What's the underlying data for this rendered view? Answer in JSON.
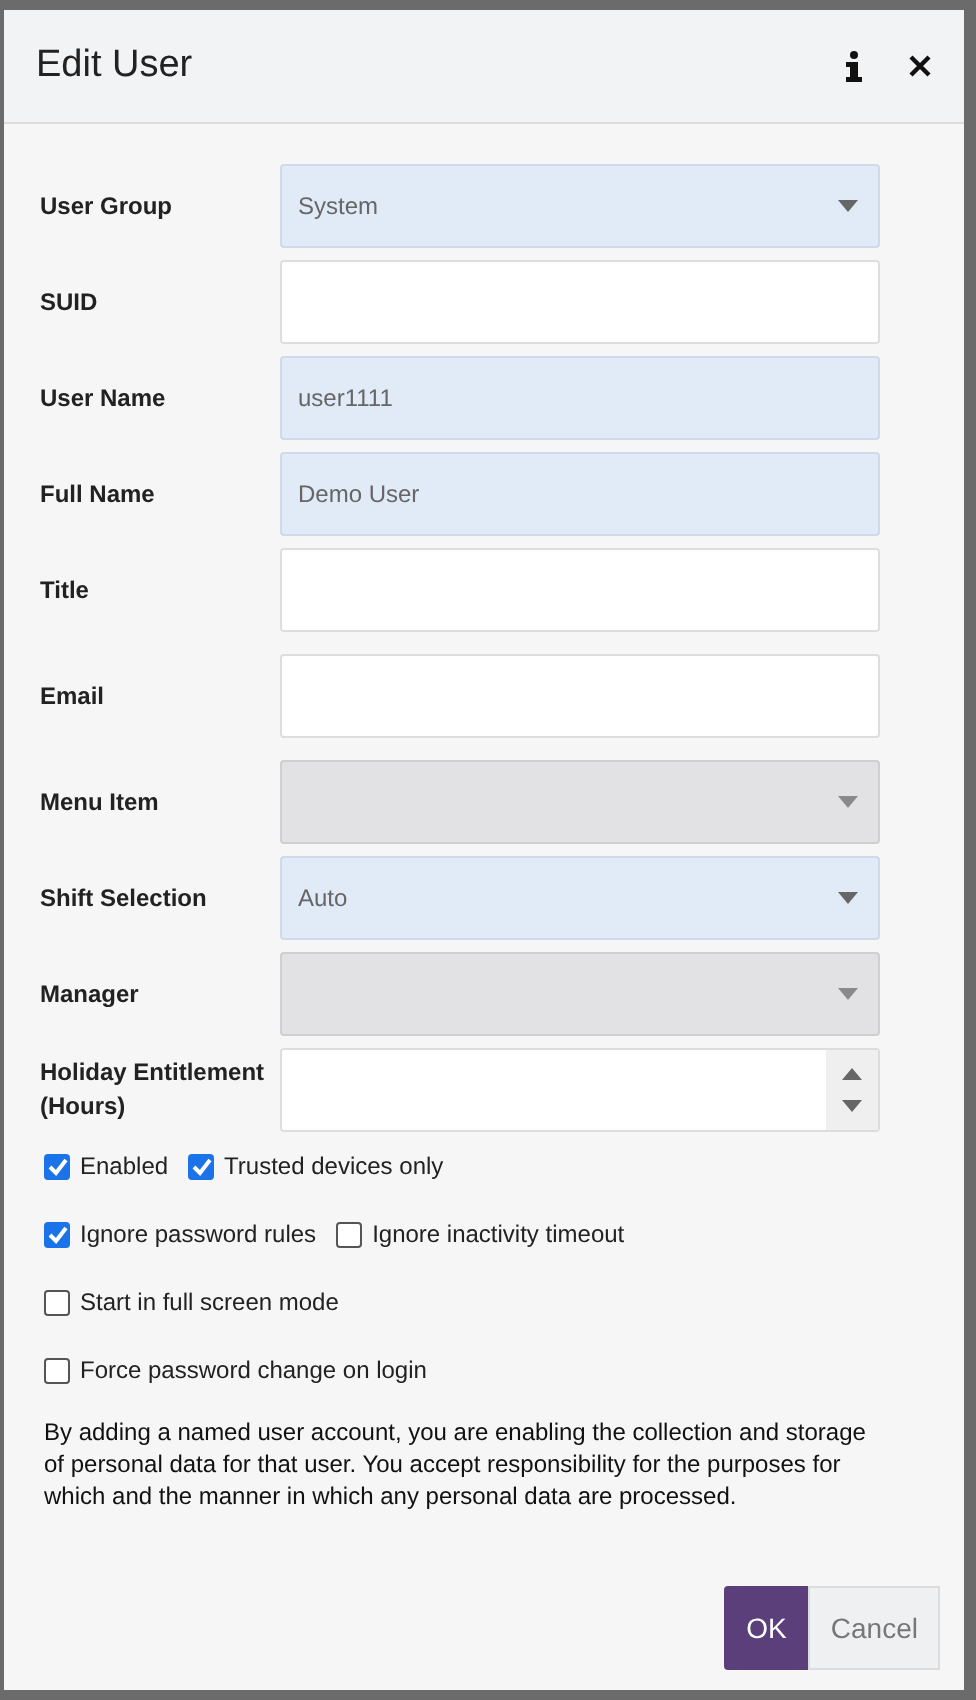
{
  "window": {
    "title": "Edit User"
  },
  "fields": [
    {
      "label": "User Group",
      "kind": "select",
      "value": "System",
      "disabled": false
    },
    {
      "label": "SUID",
      "kind": "text",
      "disabled": false
    },
    {
      "label": "User Name",
      "kind": "text",
      "value": "user1111",
      "disabled": false
    },
    {
      "label": "Full Name",
      "kind": "text",
      "value": "Demo User",
      "disabled": false
    },
    {
      "label": "Title",
      "kind": "text",
      "disabled": false
    },
    {
      "label": "Email",
      "kind": "text",
      "disabled": false
    },
    {
      "label": "Menu Item",
      "kind": "select",
      "disabled": true
    },
    {
      "label": "Shift Selection",
      "kind": "select",
      "value": "Auto",
      "disabled": false
    },
    {
      "label": "Manager",
      "kind": "select",
      "disabled": true
    },
    {
      "label": "Holiday Entitlement (Hours)",
      "kind": "number",
      "disabled": false
    }
  ],
  "checkbox_lines": [
    [
      {
        "label": "Enabled",
        "checked": true
      },
      {
        "label": "Trusted devices only",
        "checked": true
      }
    ],
    [
      {
        "label": "Ignore password rules",
        "checked": true
      },
      {
        "label": "Ignore inactivity timeout",
        "checked": false
      }
    ],
    [
      {
        "label": "Start in full screen mode",
        "checked": false
      }
    ],
    [
      {
        "label": "Force password change on login",
        "checked": false
      }
    ]
  ],
  "notice": "By adding a named user account, you are enabling the collection and storage of personal data for that user.  You accept responsibility for the purposes for which and the manner in which any personal data are processed.",
  "buttons": [
    {
      "label": "OK",
      "kind": "primary"
    },
    {
      "label": "Cancel",
      "kind": "secondary"
    }
  ]
}
